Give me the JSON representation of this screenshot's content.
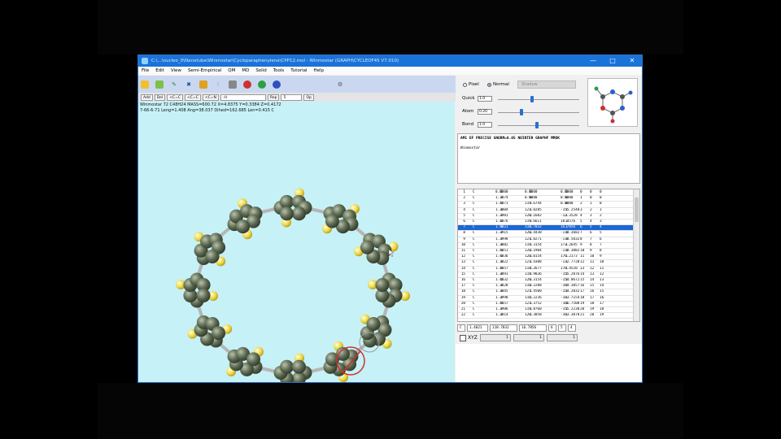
{
  "window": {
    "title": "C:\\...\\nucleo_0\\Nanotube\\Winmostar\\Cycloparaphenylene\\CPP12.mol - Winmostar (GRAPH\\CYCLEOF45 V7.010)",
    "controls": {
      "minimize": "—",
      "maximize": "□",
      "close": "✕"
    }
  },
  "menubar": [
    "File",
    "Edit",
    "View",
    "Semi-Empirical",
    "QM",
    "MD",
    "Solid",
    "Tools",
    "Tutorial",
    "Help"
  ],
  "toolbar2": [
    "Add",
    "Del",
    "<C=C",
    "<C=C",
    "<C=N",
    "-H",
    "Rep",
    "5",
    "Op"
  ],
  "viewport_info": {
    "line1": "Winmostar  72  C48H24  MASS=600.72  X=4.8375  Y=0.3384  Z=0.4172",
    "line2": "7-66-6-71  Leng=1.408  Ang=38.037  Dihed=162.685  Len=0.415  C"
  },
  "display_mode": {
    "options": [
      "Pixel",
      "Normal",
      "Shadow"
    ],
    "selected": "Normal"
  },
  "sliders": [
    {
      "label": "Quick",
      "value": "1.0",
      "pos": 0.42
    },
    {
      "label": "Atom",
      "value": "0.20",
      "pos": 0.28
    },
    {
      "label": "Bond",
      "value": "1.0",
      "pos": 0.48
    }
  ],
  "text_panel": {
    "line1": "AM1 EF PRECISE GNORM=0.05 NOINTER GRAPHF MMOK",
    "line2": "Winmostar"
  },
  "atom_table": {
    "selected_index": 6,
    "rows": [
      [
        "1",
        "C",
        "0.0000",
        "0",
        "0.0000",
        "0",
        "0.0000",
        "0",
        "0",
        "0",
        "0"
      ],
      [
        "2",
        "C",
        "1.3874",
        "1",
        "0.0000",
        "0",
        "0.0000",
        "0",
        "1",
        "0",
        "0"
      ],
      [
        "3",
        "C",
        "1.4071",
        "1",
        "119.6744",
        "1",
        "0.0000",
        "0",
        "2",
        "1",
        "0"
      ],
      [
        "4",
        "C",
        "1.3804",
        "1",
        "121.0285",
        "1",
        "-155.2548",
        "1",
        "3",
        "2",
        "1"
      ],
      [
        "5",
        "C",
        "1.3981",
        "1",
        "120.1682",
        "1",
        "-12.3528",
        "1",
        "4",
        "3",
        "2"
      ],
      [
        "6",
        "C",
        "1.4076",
        "1",
        "119.6611",
        "1",
        "18.4576",
        "1",
        "5",
        "4",
        "3"
      ],
      [
        "7",
        "C",
        "1.4021",
        "1",
        "118.7832",
        "1",
        "16.7856",
        "1",
        "6",
        "5",
        "4"
      ],
      [
        "8",
        "C",
        "1.3915",
        "1",
        "120.4438",
        "1",
        "-178.3682",
        "1",
        "7",
        "6",
        "5"
      ],
      [
        "9",
        "C",
        "1.3998",
        "1",
        "121.8271",
        "1",
        "-170.5032",
        "1",
        "8",
        "7",
        "6"
      ],
      [
        "10",
        "C",
        "1.3882",
        "1",
        "119.3154",
        "1",
        "173.2645",
        "1",
        "9",
        "8",
        "7"
      ],
      [
        "11",
        "C",
        "1.4051",
        "1",
        "120.1904",
        "1",
        "-170.3082",
        "1",
        "10",
        "9",
        "8"
      ],
      [
        "12",
        "C",
        "1.4836",
        "1",
        "120.0154",
        "1",
        "176.2173",
        "1",
        "11",
        "10",
        "9"
      ],
      [
        "13",
        "C",
        "1.3822",
        "1",
        "121.4308",
        "1",
        "-172.7720",
        "1",
        "12",
        "11",
        "10"
      ],
      [
        "14",
        "C",
        "1.4057",
        "1",
        "114.2677",
        "1",
        "170.4510",
        "1",
        "13",
        "12",
        "11"
      ],
      [
        "15",
        "C",
        "1.3891",
        "1",
        "119.9836",
        "1",
        "-155.2076",
        "1",
        "14",
        "13",
        "12"
      ],
      [
        "16",
        "C",
        "1.4032",
        "1",
        "120.3154",
        "1",
        "-154.0672",
        "1",
        "15",
        "14",
        "13"
      ],
      [
        "17",
        "C",
        "1.3828",
        "1",
        "118.2288",
        "1",
        "-164.3057",
        "1",
        "16",
        "15",
        "14"
      ],
      [
        "18",
        "C",
        "1.3845",
        "1",
        "121.4500",
        "1",
        "-154.2032",
        "1",
        "17",
        "16",
        "15"
      ],
      [
        "19",
        "C",
        "1.3998",
        "1",
        "116.2236",
        "1",
        "-163.7154",
        "1",
        "18",
        "17",
        "16"
      ],
      [
        "20",
        "C",
        "1.4057",
        "1",
        "121.3752",
        "1",
        "-166.7508",
        "1",
        "19",
        "18",
        "17"
      ],
      [
        "21",
        "C",
        "1.3906",
        "1",
        "119.8760",
        "1",
        "-155.2238",
        "1",
        "20",
        "19",
        "18"
      ],
      [
        "22",
        "C",
        "1.3814",
        "1",
        "120.3058",
        "1",
        "-163.3078",
        "1",
        "21",
        "20",
        "19"
      ]
    ]
  },
  "edit_row": [
    "C",
    "1.4021",
    "118.7832",
    "16.7856",
    "6",
    "5",
    "4"
  ],
  "xyz_row": {
    "label": "XYZ",
    "fields": [
      "1",
      "1",
      "1"
    ]
  }
}
